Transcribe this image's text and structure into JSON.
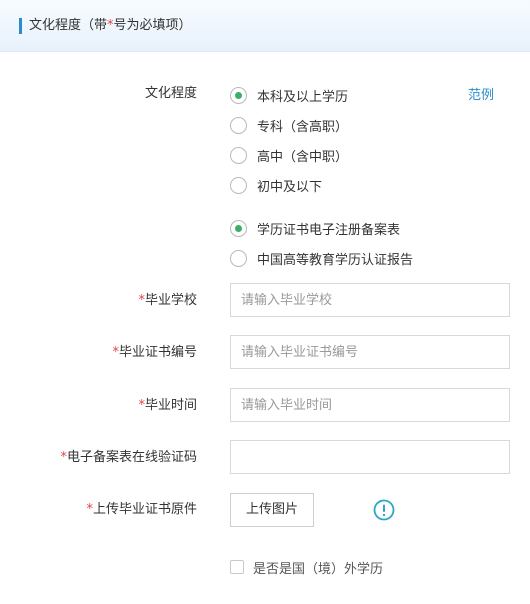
{
  "header": {
    "title_prefix": "文化程度（带",
    "title_star": "*",
    "title_suffix": "号为必填项）"
  },
  "education": {
    "label": "文化程度",
    "example_link": "范例",
    "levels": [
      {
        "label": "本科及以上学历",
        "checked": true
      },
      {
        "label": "专科（含高职）",
        "checked": false
      },
      {
        "label": "高中（含中职）",
        "checked": false
      },
      {
        "label": "初中及以下",
        "checked": false
      }
    ],
    "proof_types": [
      {
        "label": "学历证书电子注册备案表",
        "checked": true
      },
      {
        "label": "中国高等教育学历认证报告",
        "checked": false
      }
    ]
  },
  "fields": {
    "school": {
      "required_mark": "*",
      "label": "毕业学校",
      "placeholder": "请输入毕业学校",
      "value": ""
    },
    "cert_no": {
      "required_mark": "*",
      "label": "毕业证书编号",
      "placeholder": "请输入毕业证书编号",
      "value": ""
    },
    "grad_time": {
      "required_mark": "*",
      "label": "毕业时间",
      "placeholder": "请输入毕业时间",
      "value": ""
    },
    "verify_code": {
      "required_mark": "*",
      "label": "电子备案表在线验证码",
      "placeholder": "",
      "value": ""
    }
  },
  "upload": {
    "required_mark": "*",
    "label": "上传毕业证书原件",
    "button_label": "上传图片",
    "info_icon": "info-icon"
  },
  "overseas": {
    "label": "是否是国（境）外学历",
    "checked": false
  },
  "colors": {
    "accent": "#2a8ccd",
    "required": "#e64340",
    "radio_checked": "#3ab067"
  }
}
